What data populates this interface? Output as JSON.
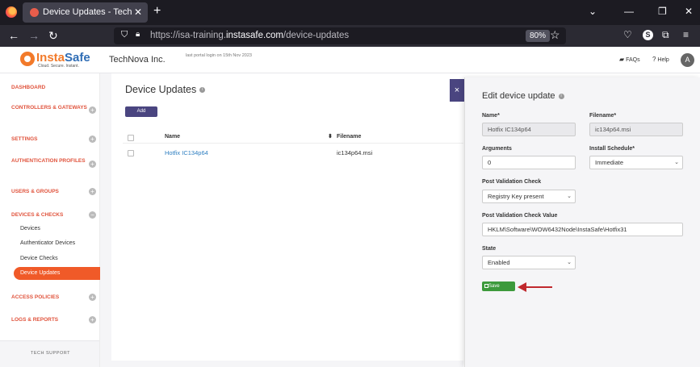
{
  "browser": {
    "tab_title": "Device Updates - TechNova Inc",
    "url_prefix": "https://isa-training.",
    "url_domain": "instasafe.com",
    "url_path": "/device-updates",
    "zoom": "80%"
  },
  "header": {
    "logo_text_a": "Insta",
    "logo_text_b": "Safe",
    "logo_tagline": "Cloud. Secure. Instant.",
    "org_name": "TechNova Inc.",
    "last_login": "last portal login on 15th Nov 2023",
    "faq": "FAQs",
    "help": "Help",
    "avatar": "A"
  },
  "sidebar": {
    "items": [
      {
        "label": "DASHBOARD"
      },
      {
        "label": "CONTROLLERS & GATEWAYS"
      },
      {
        "label": "SETTINGS"
      },
      {
        "label": "AUTHENTICATION PROFILES"
      },
      {
        "label": "USERS & GROUPS"
      },
      {
        "label": "DEVICES & CHECKS"
      },
      {
        "label": "ACCESS POLICIES"
      },
      {
        "label": "LOGS & REPORTS"
      }
    ],
    "sub_items": [
      "Devices",
      "Authenticator Devices",
      "Device Checks",
      "Device Updates"
    ],
    "footer": "TECH SUPPORT"
  },
  "main": {
    "title": "Device Updates",
    "add_label": "Add",
    "columns": [
      "Name",
      "Filename"
    ],
    "rows": [
      {
        "name": "Hotfix IC134p64",
        "filename": "ic134p64.msi"
      }
    ]
  },
  "panel": {
    "title": "Edit device update",
    "close": "×",
    "name_label": "Name*",
    "name_value": "Hotfix IC134p64",
    "filename_label": "Filename*",
    "filename_value": "ic134p64.msi",
    "arguments_label": "Arguments",
    "arguments_value": "0",
    "schedule_label": "Install Schedule*",
    "schedule_value": "Immediate",
    "pvc_label": "Post Validation Check",
    "pvc_value": "Registry Key present",
    "pvcv_label": "Post Validation Check Value",
    "pvcv_value": "HKLM\\Software\\WOW6432Node\\InstaSafe\\Hotfix31",
    "state_label": "State",
    "state_value": "Enabled",
    "save_label": "Save"
  },
  "colors": {
    "accent": "#f05a28",
    "primary": "#4a4580",
    "save": "#3d9a3c",
    "link": "#2f7fc1",
    "arrow": "#c0282d"
  }
}
